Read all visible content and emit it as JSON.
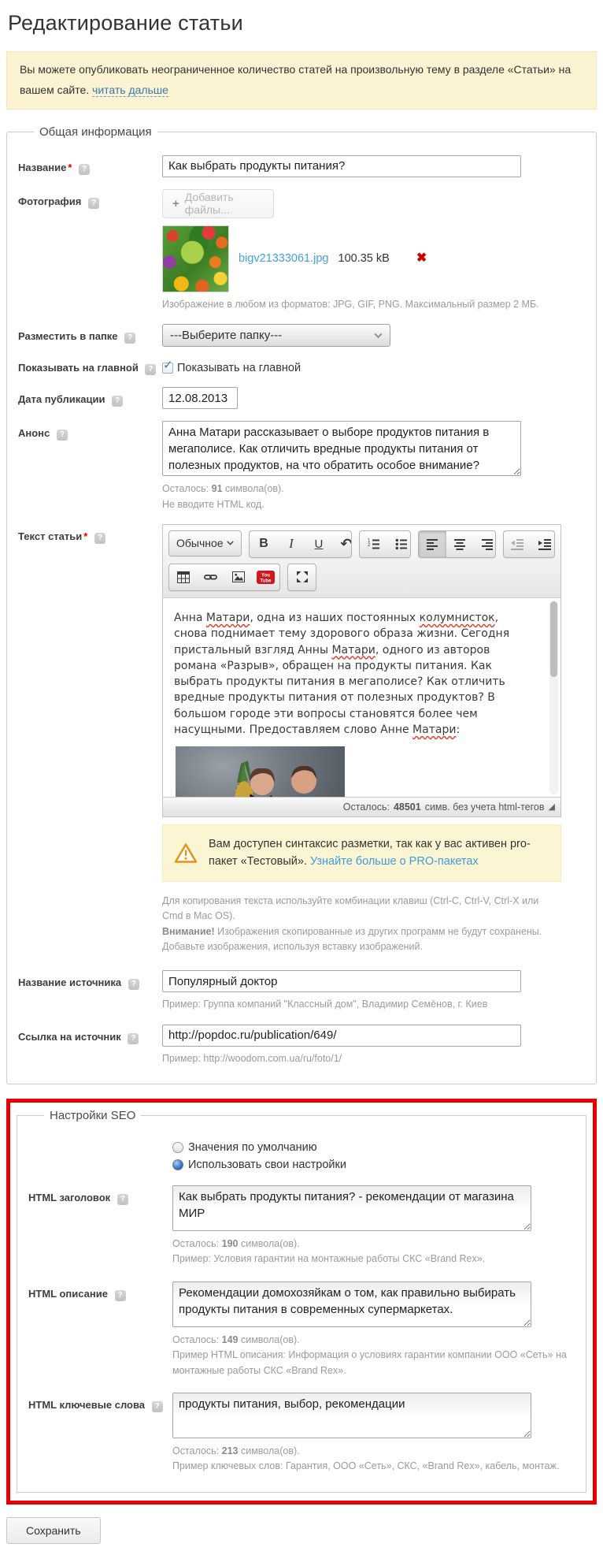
{
  "icons": {
    "help": "?",
    "plus": "+",
    "close": "✖",
    "check": "✓",
    "resize_corner": "◢",
    "undo": "↶",
    "youtube_line1": "You",
    "youtube_line2": "Tube"
  },
  "colors": {
    "highlight_border": "#e80000",
    "notice_background": "#fbf3d1",
    "link_blue": "#3b9ddd",
    "misspell_red": "#e03a2f"
  },
  "page": {
    "title": "Редактирование статьи"
  },
  "intro": {
    "text": "Вы можете опубликовать неограниченное количество статей на произвольную тему в разделе «Статьи» на вашем сайте.",
    "read_more": "читать дальше"
  },
  "general": {
    "legend": "Общая информация",
    "name": {
      "label": "Название",
      "required": "*",
      "value": "Как выбрать продукты питания?"
    },
    "photo": {
      "label": "Фотография",
      "add_files": "Добавить файлы...",
      "filename": "bigv21333061.jpg",
      "filesize": "100.35 kB",
      "hint": "Изображение в любом из форматов: JPG, GIF, PNG. Максимальный размер 2 МБ."
    },
    "folder": {
      "label": "Разместить в папке",
      "selected": "---Выберите папку---"
    },
    "show_on_main": {
      "label": "Показывать на главной",
      "checkbox_label": "Показывать на главной"
    },
    "pub_date": {
      "label": "Дата публикации",
      "value": "12.08.2013"
    },
    "announce": {
      "label": "Анонс",
      "value": "Анна Матари рассказывает о выборе продуктов питания в мегаполисе. Как отличить вредные продукты питания от полезных продуктов, на что обратить особое внимание?",
      "remaining_label": "Осталось:",
      "remaining_count": "91",
      "remaining_suffix": "символа(ов).",
      "no_html_hint": "Не вводите HTML код."
    },
    "article": {
      "label": "Текст статьи",
      "required": "*",
      "style_select": "Обычное",
      "segments": [
        {
          "text": "Анна "
        },
        {
          "text": "Матари",
          "misspelled": true
        },
        {
          "text": ", одна из наших постоянных "
        },
        {
          "text": "колумнисток",
          "misspelled": true
        },
        {
          "text": ", снова поднимает тему здорового образа жизни. Сегодня пристальный взгляд Анны "
        },
        {
          "text": "Матари",
          "misspelled": true
        },
        {
          "text": ", одного из авторов романа «Разрыв», обращен на продукты питания. Как выбрать продукты питания в мегаполисе? Как отличить вредные продукты питания от полезных продуктов? В большом городе эти вопросы становятся более чем насущными. Предоставляем слово Анне "
        },
        {
          "text": "Матари",
          "misspelled": true
        },
        {
          "text": ":"
        }
      ],
      "counter_label": "Осталось:",
      "counter_count": "48501",
      "counter_suffix": "симв. без учета html-тегов",
      "pro_notice_text": "Вам доступен синтаксис разметки, так как у вас активен pro-пакет «Тестовый».",
      "pro_notice_link": "Узнайте больше о PRO-пакетах",
      "copy_hint_line1": "Для копирования текста используйте комбинации клавиш (Ctrl-C, Ctrl-V, Ctrl-X или Cmd в Mac OS).",
      "copy_hint_warning": "Внимание!",
      "copy_hint_line2": "Изображения скопированные из других программ не будут сохранены. Добавьте изображения, используя вставку изображений."
    },
    "source_name": {
      "label": "Название источника",
      "value": "Популярный доктор",
      "hint": "Пример: Группа компаний \"Классный дом\", Владимир Семёнов, г. Киев"
    },
    "source_link": {
      "label": "Ссылка на источник",
      "value": "http://popdoc.ru/publication/649/",
      "hint": "Пример: http://woodom.com.ua/ru/foto/1/"
    }
  },
  "seo": {
    "legend": "Настройки SEO",
    "radio_default": "Значения по умолчанию",
    "radio_custom": "Использовать свои настройки",
    "html_title": {
      "label": "HTML заголовок",
      "value": "Как выбрать продукты питания? - рекомендации от магазина МИР",
      "remaining_label": "Осталось:",
      "remaining_count": "190",
      "remaining_suffix": "символа(ов).",
      "example": "Пример: Условия гарантии на монтажные работы СКС «Brand Rex»."
    },
    "html_description": {
      "label": "HTML описание",
      "value": "Рекомендации домохозяйкам о том, как правильно выбирать продукты питания в современных супермаркетах.",
      "remaining_label": "Осталось:",
      "remaining_count": "149",
      "remaining_suffix": "символа(ов).",
      "example": "Пример HTML описания: Информация о условиях гарантии компании ООО «Сеть» на монтажные работы СКС «Brand Rex»."
    },
    "html_keywords": {
      "label": "HTML ключевые слова",
      "value": "продукты питания, выбор, рекомендации",
      "remaining_label": "Осталось:",
      "remaining_count": "213",
      "remaining_suffix": "символа(ов).",
      "example": "Пример ключевых слов: Гарантия, ООО «Сеть», СКС, «Brand Rex», кабель, монтаж."
    }
  },
  "footer": {
    "save": "Сохранить"
  }
}
